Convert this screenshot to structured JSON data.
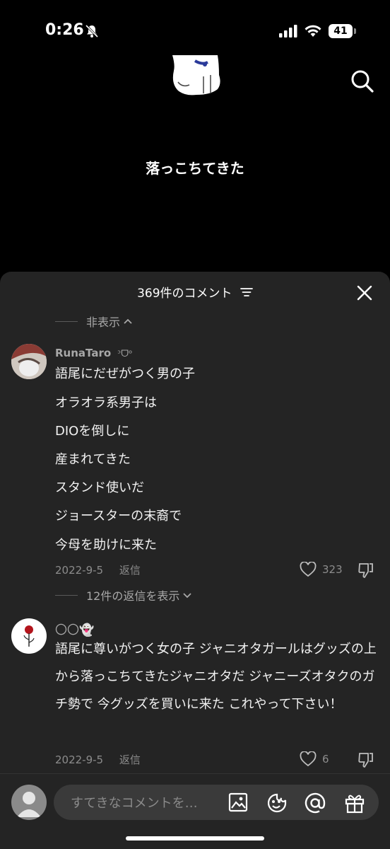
{
  "status_bar": {
    "time": "0:26",
    "battery": "41"
  },
  "video": {
    "caption": "落っこちてきた"
  },
  "comments_sheet": {
    "title": "369件のコメント",
    "hide_label": "非表示",
    "comments": [
      {
        "username": "RunaTaro",
        "badge": "ᵓᗜᵒ",
        "lines": [
          "語尾にだぜがつく男の子",
          "オラオラ系男子は",
          "DIOを倒しに",
          "産まれてきた",
          "スタンド使いだ",
          "ジョースターの末裔で",
          "今母を助けに来た"
        ],
        "date": "2022-9-5",
        "reply_label": "返信",
        "likes": "323",
        "view_replies": "12件の返信を表示"
      },
      {
        "username": "〇〇👻",
        "text": "語尾に尊いがつく女の子 ジャニオタガールはグッズの上から落っこちてきたジャニオタだ ジャニーズオタクのガチ勢で 今グッズを買いに来た これやって下さい！",
        "date": "2022-9-5",
        "reply_label": "返信",
        "likes": "6"
      }
    ]
  },
  "input": {
    "placeholder": "すてきなコメントを…"
  },
  "icons": {
    "search": "search-icon",
    "close": "close-icon",
    "filter": "filter-icon",
    "like": "heart-icon",
    "dislike": "thumbs-down-icon",
    "image": "image-icon",
    "emoji": "emoji-icon",
    "mention": "at-icon",
    "gift": "gift-icon"
  }
}
